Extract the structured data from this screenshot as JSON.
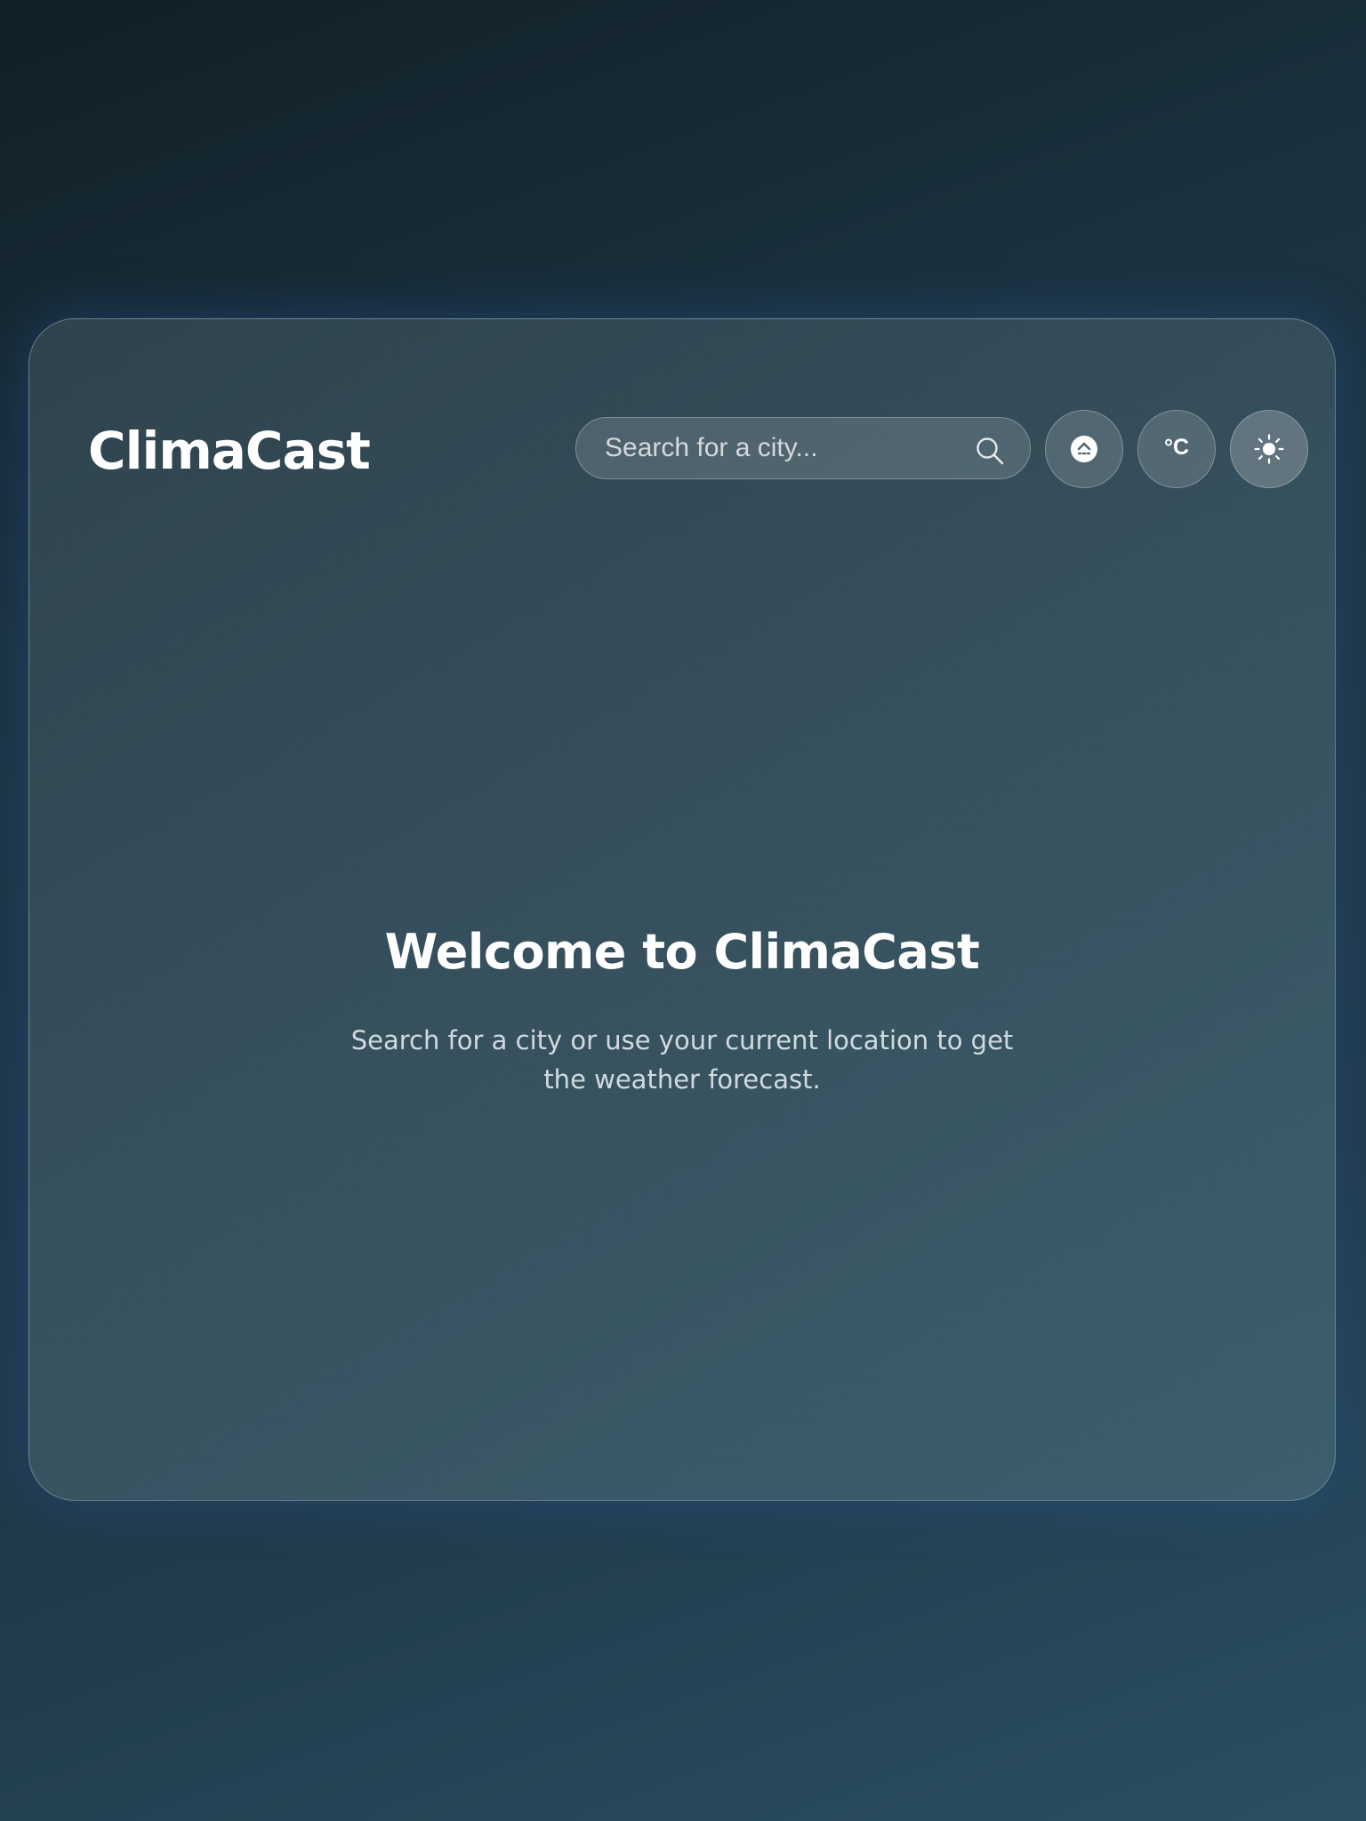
{
  "app": {
    "title": "ClimaCast"
  },
  "search": {
    "placeholder": "Search for a city...",
    "icon": "search-icon"
  },
  "controls": {
    "location_icon": "location-icon",
    "unit_label": "°C",
    "theme_icon": "sun-icon"
  },
  "welcome": {
    "title": "Welcome to ClimaCast",
    "message": "Search for a city or use your current location to get the weather forecast."
  },
  "colors": {
    "card_border": "#aabec8",
    "text_primary": "#ffffff"
  }
}
